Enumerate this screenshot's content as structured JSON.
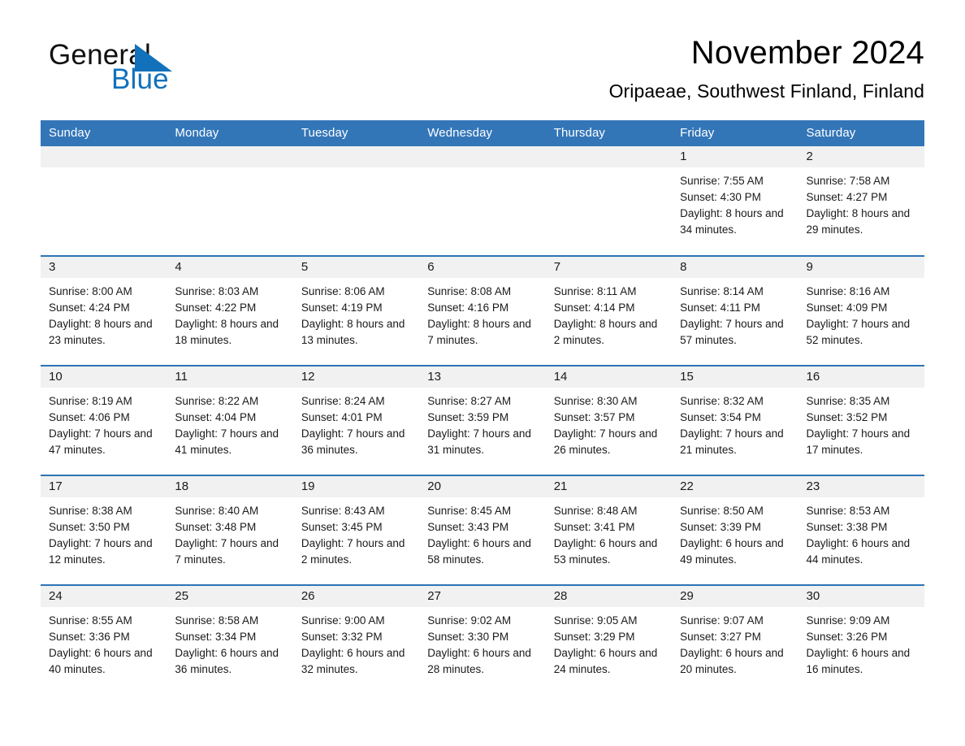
{
  "brand": {
    "name_part1": "General",
    "name_part2": "Blue",
    "accent_color": "#1271bb",
    "triangle_icon": "triangle-icon"
  },
  "header": {
    "title": "November 2024",
    "subtitle": "Oripaeae, Southwest Finland, Finland"
  },
  "calendar": {
    "header_bg": "#3376b8",
    "row_divider": "#2e74b5",
    "daynum_bg": "#f1f1f1",
    "weekdays": [
      "Sunday",
      "Monday",
      "Tuesday",
      "Wednesday",
      "Thursday",
      "Friday",
      "Saturday"
    ],
    "labels": {
      "sunrise": "Sunrise:",
      "sunset": "Sunset:",
      "daylight": "Daylight:"
    },
    "weeks": [
      [
        {
          "day": "",
          "empty": true
        },
        {
          "day": "",
          "empty": true
        },
        {
          "day": "",
          "empty": true
        },
        {
          "day": "",
          "empty": true
        },
        {
          "day": "",
          "empty": true
        },
        {
          "day": "1",
          "sunrise": "Sunrise: 7:55 AM",
          "sunset": "Sunset: 4:30 PM",
          "daylight": "Daylight: 8 hours and 34 minutes."
        },
        {
          "day": "2",
          "sunrise": "Sunrise: 7:58 AM",
          "sunset": "Sunset: 4:27 PM",
          "daylight": "Daylight: 8 hours and 29 minutes."
        }
      ],
      [
        {
          "day": "3",
          "sunrise": "Sunrise: 8:00 AM",
          "sunset": "Sunset: 4:24 PM",
          "daylight": "Daylight: 8 hours and 23 minutes."
        },
        {
          "day": "4",
          "sunrise": "Sunrise: 8:03 AM",
          "sunset": "Sunset: 4:22 PM",
          "daylight": "Daylight: 8 hours and 18 minutes."
        },
        {
          "day": "5",
          "sunrise": "Sunrise: 8:06 AM",
          "sunset": "Sunset: 4:19 PM",
          "daylight": "Daylight: 8 hours and 13 minutes."
        },
        {
          "day": "6",
          "sunrise": "Sunrise: 8:08 AM",
          "sunset": "Sunset: 4:16 PM",
          "daylight": "Daylight: 8 hours and 7 minutes."
        },
        {
          "day": "7",
          "sunrise": "Sunrise: 8:11 AM",
          "sunset": "Sunset: 4:14 PM",
          "daylight": "Daylight: 8 hours and 2 minutes."
        },
        {
          "day": "8",
          "sunrise": "Sunrise: 8:14 AM",
          "sunset": "Sunset: 4:11 PM",
          "daylight": "Daylight: 7 hours and 57 minutes."
        },
        {
          "day": "9",
          "sunrise": "Sunrise: 8:16 AM",
          "sunset": "Sunset: 4:09 PM",
          "daylight": "Daylight: 7 hours and 52 minutes."
        }
      ],
      [
        {
          "day": "10",
          "sunrise": "Sunrise: 8:19 AM",
          "sunset": "Sunset: 4:06 PM",
          "daylight": "Daylight: 7 hours and 47 minutes."
        },
        {
          "day": "11",
          "sunrise": "Sunrise: 8:22 AM",
          "sunset": "Sunset: 4:04 PM",
          "daylight": "Daylight: 7 hours and 41 minutes."
        },
        {
          "day": "12",
          "sunrise": "Sunrise: 8:24 AM",
          "sunset": "Sunset: 4:01 PM",
          "daylight": "Daylight: 7 hours and 36 minutes."
        },
        {
          "day": "13",
          "sunrise": "Sunrise: 8:27 AM",
          "sunset": "Sunset: 3:59 PM",
          "daylight": "Daylight: 7 hours and 31 minutes."
        },
        {
          "day": "14",
          "sunrise": "Sunrise: 8:30 AM",
          "sunset": "Sunset: 3:57 PM",
          "daylight": "Daylight: 7 hours and 26 minutes."
        },
        {
          "day": "15",
          "sunrise": "Sunrise: 8:32 AM",
          "sunset": "Sunset: 3:54 PM",
          "daylight": "Daylight: 7 hours and 21 minutes."
        },
        {
          "day": "16",
          "sunrise": "Sunrise: 8:35 AM",
          "sunset": "Sunset: 3:52 PM",
          "daylight": "Daylight: 7 hours and 17 minutes."
        }
      ],
      [
        {
          "day": "17",
          "sunrise": "Sunrise: 8:38 AM",
          "sunset": "Sunset: 3:50 PM",
          "daylight": "Daylight: 7 hours and 12 minutes."
        },
        {
          "day": "18",
          "sunrise": "Sunrise: 8:40 AM",
          "sunset": "Sunset: 3:48 PM",
          "daylight": "Daylight: 7 hours and 7 minutes."
        },
        {
          "day": "19",
          "sunrise": "Sunrise: 8:43 AM",
          "sunset": "Sunset: 3:45 PM",
          "daylight": "Daylight: 7 hours and 2 minutes."
        },
        {
          "day": "20",
          "sunrise": "Sunrise: 8:45 AM",
          "sunset": "Sunset: 3:43 PM",
          "daylight": "Daylight: 6 hours and 58 minutes."
        },
        {
          "day": "21",
          "sunrise": "Sunrise: 8:48 AM",
          "sunset": "Sunset: 3:41 PM",
          "daylight": "Daylight: 6 hours and 53 minutes."
        },
        {
          "day": "22",
          "sunrise": "Sunrise: 8:50 AM",
          "sunset": "Sunset: 3:39 PM",
          "daylight": "Daylight: 6 hours and 49 minutes."
        },
        {
          "day": "23",
          "sunrise": "Sunrise: 8:53 AM",
          "sunset": "Sunset: 3:38 PM",
          "daylight": "Daylight: 6 hours and 44 minutes."
        }
      ],
      [
        {
          "day": "24",
          "sunrise": "Sunrise: 8:55 AM",
          "sunset": "Sunset: 3:36 PM",
          "daylight": "Daylight: 6 hours and 40 minutes."
        },
        {
          "day": "25",
          "sunrise": "Sunrise: 8:58 AM",
          "sunset": "Sunset: 3:34 PM",
          "daylight": "Daylight: 6 hours and 36 minutes."
        },
        {
          "day": "26",
          "sunrise": "Sunrise: 9:00 AM",
          "sunset": "Sunset: 3:32 PM",
          "daylight": "Daylight: 6 hours and 32 minutes."
        },
        {
          "day": "27",
          "sunrise": "Sunrise: 9:02 AM",
          "sunset": "Sunset: 3:30 PM",
          "daylight": "Daylight: 6 hours and 28 minutes."
        },
        {
          "day": "28",
          "sunrise": "Sunrise: 9:05 AM",
          "sunset": "Sunset: 3:29 PM",
          "daylight": "Daylight: 6 hours and 24 minutes."
        },
        {
          "day": "29",
          "sunrise": "Sunrise: 9:07 AM",
          "sunset": "Sunset: 3:27 PM",
          "daylight": "Daylight: 6 hours and 20 minutes."
        },
        {
          "day": "30",
          "sunrise": "Sunrise: 9:09 AM",
          "sunset": "Sunset: 3:26 PM",
          "daylight": "Daylight: 6 hours and 16 minutes."
        }
      ]
    ]
  }
}
